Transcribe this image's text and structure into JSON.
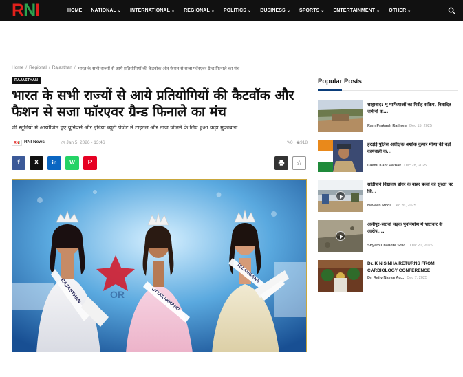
{
  "brand": {
    "logo_text_r": "R",
    "logo_text_n": "N",
    "logo_text_i": "I"
  },
  "nav": {
    "items": [
      {
        "label": "HOME",
        "has_dropdown": false
      },
      {
        "label": "NATIONAL",
        "has_dropdown": true
      },
      {
        "label": "INTERNATIONAL",
        "has_dropdown": true
      },
      {
        "label": "REGIONAL",
        "has_dropdown": true
      },
      {
        "label": "POLITICS",
        "has_dropdown": true
      },
      {
        "label": "BUSINESS",
        "has_dropdown": true
      },
      {
        "label": "SPORTS",
        "has_dropdown": true
      },
      {
        "label": "ENTERTAINMENT",
        "has_dropdown": true
      },
      {
        "label": "OTHER",
        "has_dropdown": true
      }
    ],
    "search_icon": "search-icon"
  },
  "breadcrumb": {
    "home": "Home",
    "regional": "Regional",
    "state": "Rajasthan",
    "current": "भारत के सभी राज्यों से आये प्रतियोगियों की कैटवॉक और फैशन से सजा फॉरएवर ग्रैन्ड फिनाले का मंच"
  },
  "article": {
    "category": "RAJASTHAN",
    "headline": "भारत के सभी राज्यों से आये प्रतियोगियों की कैटवॉक और फैशन से सजा फॉरएवर ग्रैन्ड फिनाले का मंच",
    "subheadline": "जी स्टूडियो में आयोजित हुए यूनिवर्स और इंडिया ब्यूटी पेजेंट में टाइटल और ताज जीतने के लिए हुआ कड़ा मुकाबला",
    "author": "RNI News",
    "date": "Jan 5, 2026 - 13:46",
    "comments": "0",
    "views": "918",
    "share": [
      "f",
      "X",
      "in",
      "W",
      "P"
    ],
    "sash_labels": [
      "RAJASTHAN",
      "UTTARAKHAND",
      "TELANGANA"
    ]
  },
  "sidebar": {
    "title": "Popular Posts",
    "posts": [
      {
        "title": "शाहाबाद: भू माफियाओं का गिरोह सक्रिय, विवादित जमीनों क...",
        "author": "Ram Prakash Rathore",
        "date": "Dec 15, 2025",
        "video": false
      },
      {
        "title": "हरदोई पुलिस अधीक्षक अशोक कुमार मीणा की बड़ी कार्यवाही क...",
        "author": "Laxmi Kant Pathak",
        "date": "Dec 28, 2025",
        "video": false
      },
      {
        "title": "सांदीपनि विद्यालय डोंगर के बाहर बच्चों की सुरक्षा पर चि...",
        "author": "Naveen Modi",
        "date": "Dec 26, 2025",
        "video": true
      },
      {
        "title": "अलीपुर–सराबां सड़क पुनर्निर्माण में भ्रष्टाचार के आरोप,...",
        "author": "Shyam Chandra Sriv...",
        "date": "Dec 20, 2025",
        "video": true
      },
      {
        "title": "Dr. K N SINHA RETURNS FROM CARDIOLOGY CONFERENCE",
        "author": "Dr. Rajiv Nayan Ag...",
        "date": "Dec 7, 2025",
        "video": false
      }
    ]
  },
  "colors": {
    "nav_bg": "#111111",
    "brand_red": "#e0201b",
    "brand_green": "#2ea44f",
    "accent_blue": "#0a3d7a"
  }
}
